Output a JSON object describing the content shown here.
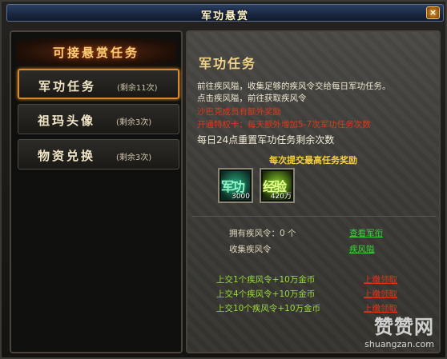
{
  "window": {
    "title": "军功悬赏",
    "close_label": "×"
  },
  "left_panel": {
    "header": "可接悬赏任务",
    "items": [
      {
        "label": "军功任务",
        "remaining": "(剩余11次)",
        "active": true
      },
      {
        "label": "祖玛头像",
        "remaining": "(剩余3次)",
        "active": false
      },
      {
        "label": "物资兑换",
        "remaining": "(剩余3次)",
        "active": false
      }
    ]
  },
  "detail": {
    "title": "军功任务",
    "desc_line1": "前往疾风隘，收集足够的疾风令交给每日军功任务。",
    "desc_line2": "点击疾风隘，前往获取疾风令",
    "red_line1": "沙巴克成员有额外奖励",
    "red_line2": "开通特权卡：每天额外增加5-7次军功任务次数",
    "reset_line": "每日24点重置军功任务剩余次数",
    "reward_title": "每次提交最高任务奖励",
    "rewards": [
      {
        "name": "军功",
        "icon": "military-merit-icon",
        "qty": "3000"
      },
      {
        "name": "经验",
        "icon": "experience-icon",
        "qty": "420万"
      }
    ],
    "owned_label": "拥有疾风令：0 个",
    "owned_link": "查看军衔",
    "collect_label": "收集疾风令",
    "collect_link": "疾风隘",
    "hand_in": [
      {
        "text": "上交1个疾风令+10万金币",
        "button": "上缴领取"
      },
      {
        "text": "上交4个疾风令+10万金币",
        "button": "上缴领取"
      },
      {
        "text": "上交10个疾风令+10万金币",
        "button": "上缴领取"
      }
    ]
  },
  "watermark": {
    "brand": "赞赞网",
    "url": "shuangzan.com"
  },
  "colors": {
    "accent_gold": "#f2d38a",
    "link_green": "#3cd43c",
    "warn_red": "#e0391d",
    "active_border": "#d9892d"
  }
}
